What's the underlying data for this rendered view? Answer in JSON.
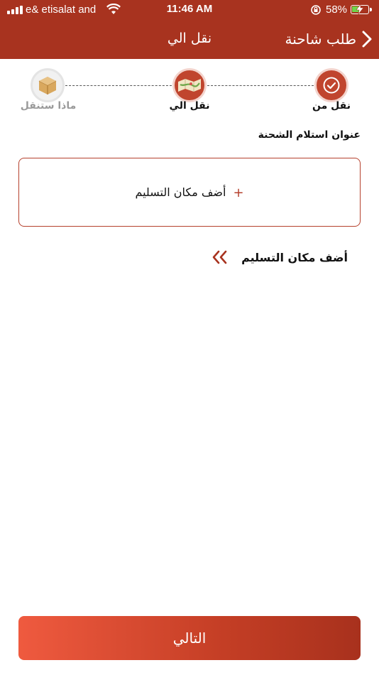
{
  "status_bar": {
    "carrier": "e& etisalat and",
    "time": "11:46 AM",
    "battery_percent": "58%",
    "battery_level": 0.58
  },
  "nav": {
    "back_label": "طلب شاحنة",
    "title": "نقل الي"
  },
  "stepper": {
    "steps": [
      {
        "label": "نقل من",
        "state": "completed",
        "icon": "check-circle-icon"
      },
      {
        "label": "نقل الي",
        "state": "active",
        "icon": "map-icon"
      },
      {
        "label": "ماذا ستنقل",
        "state": "pending",
        "icon": "box-icon"
      }
    ]
  },
  "section": {
    "title": "عنوان استلام الشحنة"
  },
  "add_box": {
    "label": "أضف مكان التسليم",
    "icon": "plus-icon"
  },
  "add_link": {
    "label": "أضف مكان التسليم",
    "icon": "double-chevron-left-icon"
  },
  "footer": {
    "next_label": "التالي"
  },
  "colors": {
    "brand": "#a8331f",
    "accent": "#b5412d",
    "button_gradient_start": "#ef5a3f",
    "button_gradient_end": "#a8311d"
  }
}
